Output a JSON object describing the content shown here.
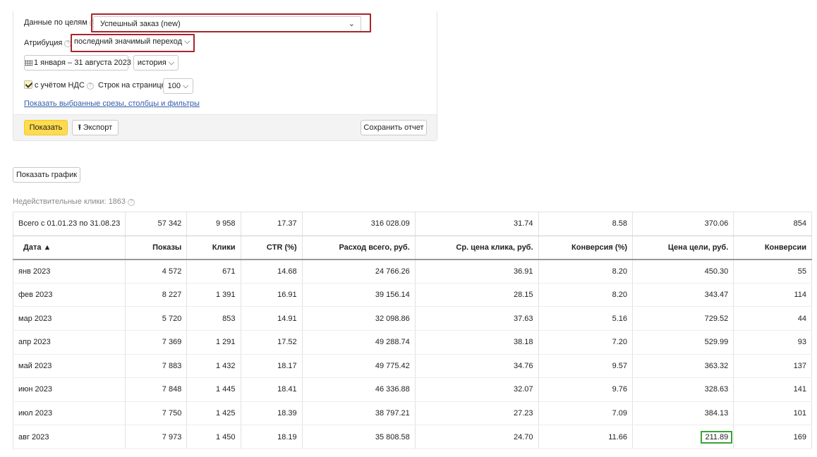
{
  "filters": {
    "goal_label": "Данные по целям",
    "goal_value": "Успешный заказ (new)",
    "attribution_label": "Атрибуция",
    "attribution_value": "последний значимый переход",
    "date_range": "1 января – 31 августа 2023",
    "history_label": "история",
    "vat_label": "с учётом НДС",
    "vat_checked": true,
    "rows_label": "Строк на странице",
    "rows_value": "100",
    "show_slices_link": "Показать выбранные срезы, столбцы и фильтры"
  },
  "footer": {
    "show_button": "Показать",
    "export_button": "Экспорт",
    "save_report_button": "Сохранить отчет"
  },
  "show_chart_button": "Показать график",
  "invalid_clicks": "Недействительные клики: 1863",
  "table": {
    "total": [
      "Всего с 01.01.23 по 31.08.23",
      "57 342",
      "9 958",
      "17.37",
      "316 028.09",
      "31.74",
      "8.58",
      "370.06",
      "854"
    ],
    "headers": [
      "Дата ▲",
      "Показы",
      "Клики",
      "CTR (%)",
      "Расход всего, руб.",
      "Ср. цена клика, руб.",
      "Конверсия (%)",
      "Цена цели, руб.",
      "Конверсии"
    ],
    "rows": [
      [
        "янв 2023",
        "4 572",
        "671",
        "14.68",
        "24 766.26",
        "36.91",
        "8.20",
        "450.30",
        "55"
      ],
      [
        "фев 2023",
        "8 227",
        "1 391",
        "16.91",
        "39 156.14",
        "28.15",
        "8.20",
        "343.47",
        "114"
      ],
      [
        "мар 2023",
        "5 720",
        "853",
        "14.91",
        "32 098.86",
        "37.63",
        "5.16",
        "729.52",
        "44"
      ],
      [
        "апр 2023",
        "7 369",
        "1 291",
        "17.52",
        "49 288.74",
        "38.18",
        "7.20",
        "529.99",
        "93"
      ],
      [
        "май 2023",
        "7 883",
        "1 432",
        "18.17",
        "49 775.42",
        "34.76",
        "9.57",
        "363.32",
        "137"
      ],
      [
        "июн 2023",
        "7 848",
        "1 445",
        "18.41",
        "46 336.88",
        "32.07",
        "9.76",
        "328.63",
        "141"
      ],
      [
        "июл 2023",
        "7 750",
        "1 425",
        "18.39",
        "38 797.21",
        "27.23",
        "7.09",
        "384.13",
        "101"
      ],
      [
        "авг 2023",
        "7 973",
        "1 450",
        "18.19",
        "35 808.58",
        "24.70",
        "11.66",
        "211.89",
        "169"
      ]
    ]
  },
  "colors": {
    "highlight_red": "#a8262d",
    "highlight_green": "#3aa537",
    "primary_button": "#ffdb4d",
    "link": "#335dab"
  }
}
